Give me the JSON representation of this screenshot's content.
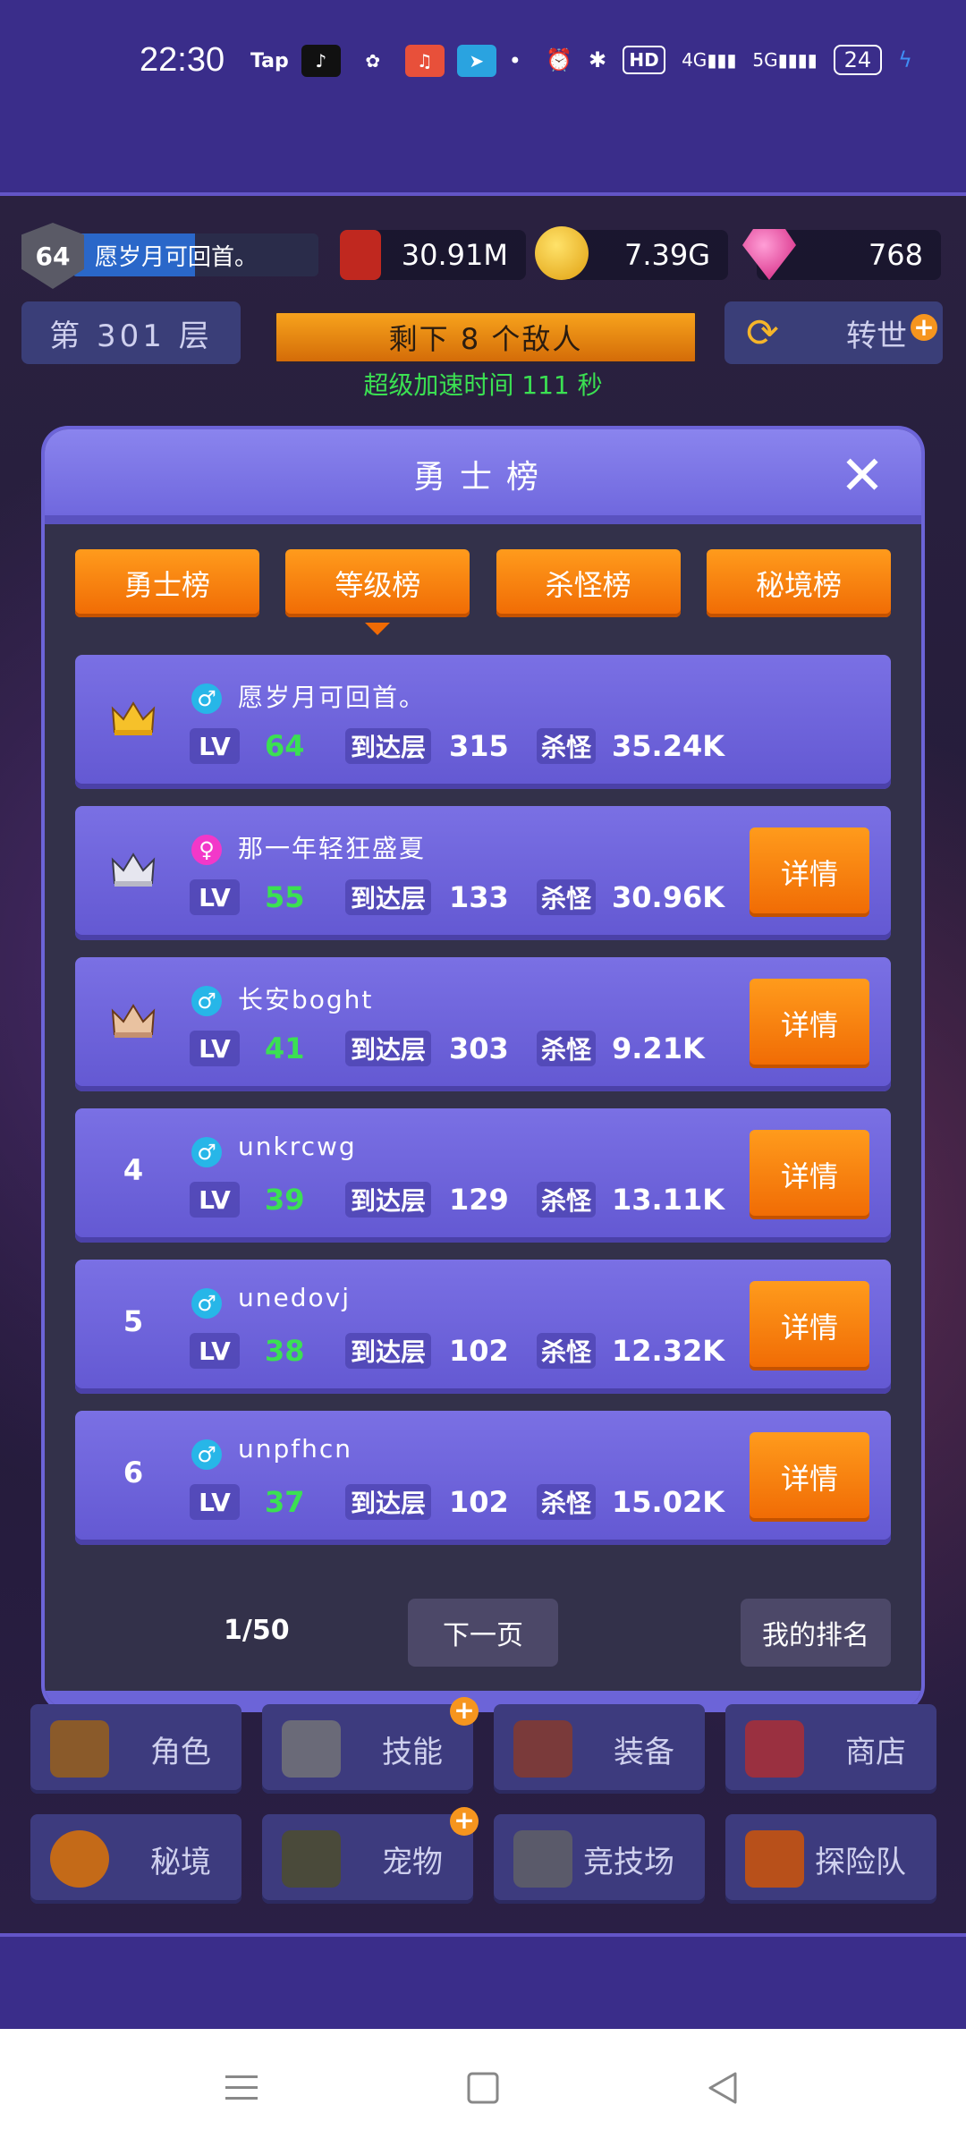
{
  "status_bar": {
    "time": "22:30",
    "tap_label": "Tap",
    "hd_label": "HD",
    "net1": "4G",
    "net2": "5G",
    "battery": "24"
  },
  "hud": {
    "player_level": "64",
    "player_name": "愿岁月可回首。",
    "book_value": "30.91M",
    "gold_value": "7.39G",
    "gem_value": "768",
    "floor_text": "第 301 层",
    "enemies_text": "剩下 8 个敌人",
    "reborn_label": "转世",
    "speed_text": "超级加速时间 111 秒"
  },
  "modal": {
    "title": "勇士榜",
    "tabs": [
      {
        "label": "勇士榜"
      },
      {
        "label": "等级榜"
      },
      {
        "label": "杀怪榜"
      },
      {
        "label": "秘境榜"
      }
    ],
    "active_tab": "等级榜",
    "labels": {
      "lv": "LV",
      "floor": "到达层",
      "kills": "杀怪",
      "detail": "详情"
    },
    "rows": [
      {
        "rank": "1",
        "gender": "♂",
        "name": "愿岁月可回首。",
        "lv": "64",
        "floor": "315",
        "kills": "35.24K"
      },
      {
        "rank": "2",
        "gender": "♀",
        "name": "那一年轻狂盛夏",
        "lv": "55",
        "floor": "133",
        "kills": "30.96K"
      },
      {
        "rank": "3",
        "gender": "♂",
        "name": "长安boght",
        "lv": "41",
        "floor": "303",
        "kills": "9.21K"
      },
      {
        "rank": "4",
        "gender": "♂",
        "name": "unkrcwg",
        "lv": "39",
        "floor": "129",
        "kills": "13.11K"
      },
      {
        "rank": "5",
        "gender": "♂",
        "name": "unedovj",
        "lv": "38",
        "floor": "102",
        "kills": "12.32K"
      },
      {
        "rank": "6",
        "gender": "♂",
        "name": "unpfhcn",
        "lv": "37",
        "floor": "102",
        "kills": "15.02K"
      }
    ],
    "pager": {
      "page": "1/50",
      "next": "下一页",
      "my_rank": "我的排名"
    }
  },
  "menu": {
    "items": [
      {
        "label": "角色"
      },
      {
        "label": "技能"
      },
      {
        "label": "装备"
      },
      {
        "label": "商店"
      },
      {
        "label": "秘境"
      },
      {
        "label": "宠物"
      },
      {
        "label": "竞技场"
      },
      {
        "label": "探险队"
      }
    ]
  },
  "colors": {
    "accent_orange": "#f06a04",
    "row_purple": "#6f64dc",
    "level_green": "#3be052",
    "male_blue": "#27b6e8",
    "female_pink": "#f238c9"
  }
}
